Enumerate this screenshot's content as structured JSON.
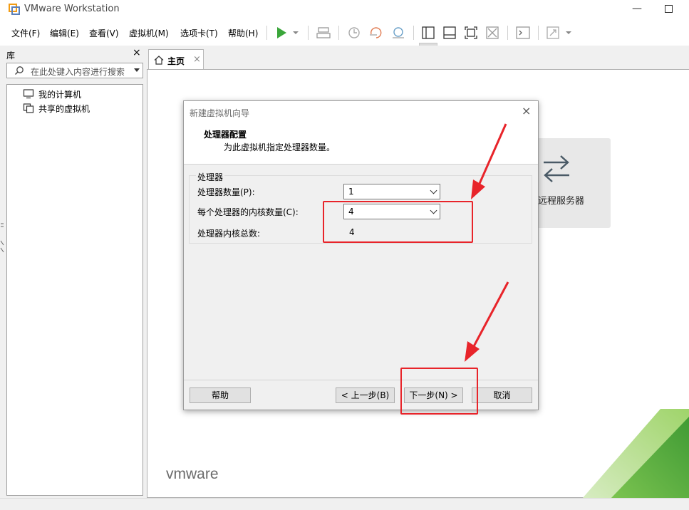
{
  "window": {
    "title": "VMware Workstation",
    "minimize_glyph": "—"
  },
  "menu": {
    "items": [
      "文件(F)",
      "编辑(E)",
      "查看(V)",
      "虚拟机(M)",
      "选项卡(T)",
      "帮助(H)"
    ]
  },
  "toolbar": {
    "icons": [
      "play-icon",
      "send-ctrl-alt-del-icon",
      "snapshot-icon",
      "revert-snapshot-icon",
      "snapshot-manager-icon",
      "show-library-icon",
      "thumbnail-bar-icon",
      "full-screen-icon",
      "unity-icon",
      "console-icon",
      "stretch-icon"
    ]
  },
  "library": {
    "title": "库",
    "close_glyph": "×",
    "search_placeholder": "在此处键入内容进行搜索",
    "items": [
      {
        "label": "我的计算机",
        "icon": "computer-icon"
      },
      {
        "label": "共享的虚拟机",
        "icon": "shared-vm-icon"
      }
    ]
  },
  "tabs": {
    "home_label": "主页",
    "close_glyph": "×"
  },
  "home": {
    "remote_server_label": "远程服务器",
    "brand": "vmware"
  },
  "dialog": {
    "title": "新建虚拟机向导",
    "close_glyph": "×",
    "heading": "处理器配置",
    "subheading": "为此虚拟机指定处理器数量。",
    "group_label": "处理器",
    "processor_count_label": "处理器数量(P):",
    "processor_count_value": "1",
    "cores_per_processor_label": "每个处理器的内核数量(C):",
    "cores_per_processor_value": "4",
    "total_cores_label": "处理器内核总数:",
    "total_cores_value": "4",
    "buttons": {
      "help": "帮助",
      "back": "< 上一步(B)",
      "next": "下一步(N) >",
      "cancel": "取消"
    }
  },
  "colors": {
    "annotation": "#e8242a",
    "play_green": "#3aa63a",
    "brand_green_light": "#9fd46a",
    "brand_green_dark": "#4ea33a"
  }
}
